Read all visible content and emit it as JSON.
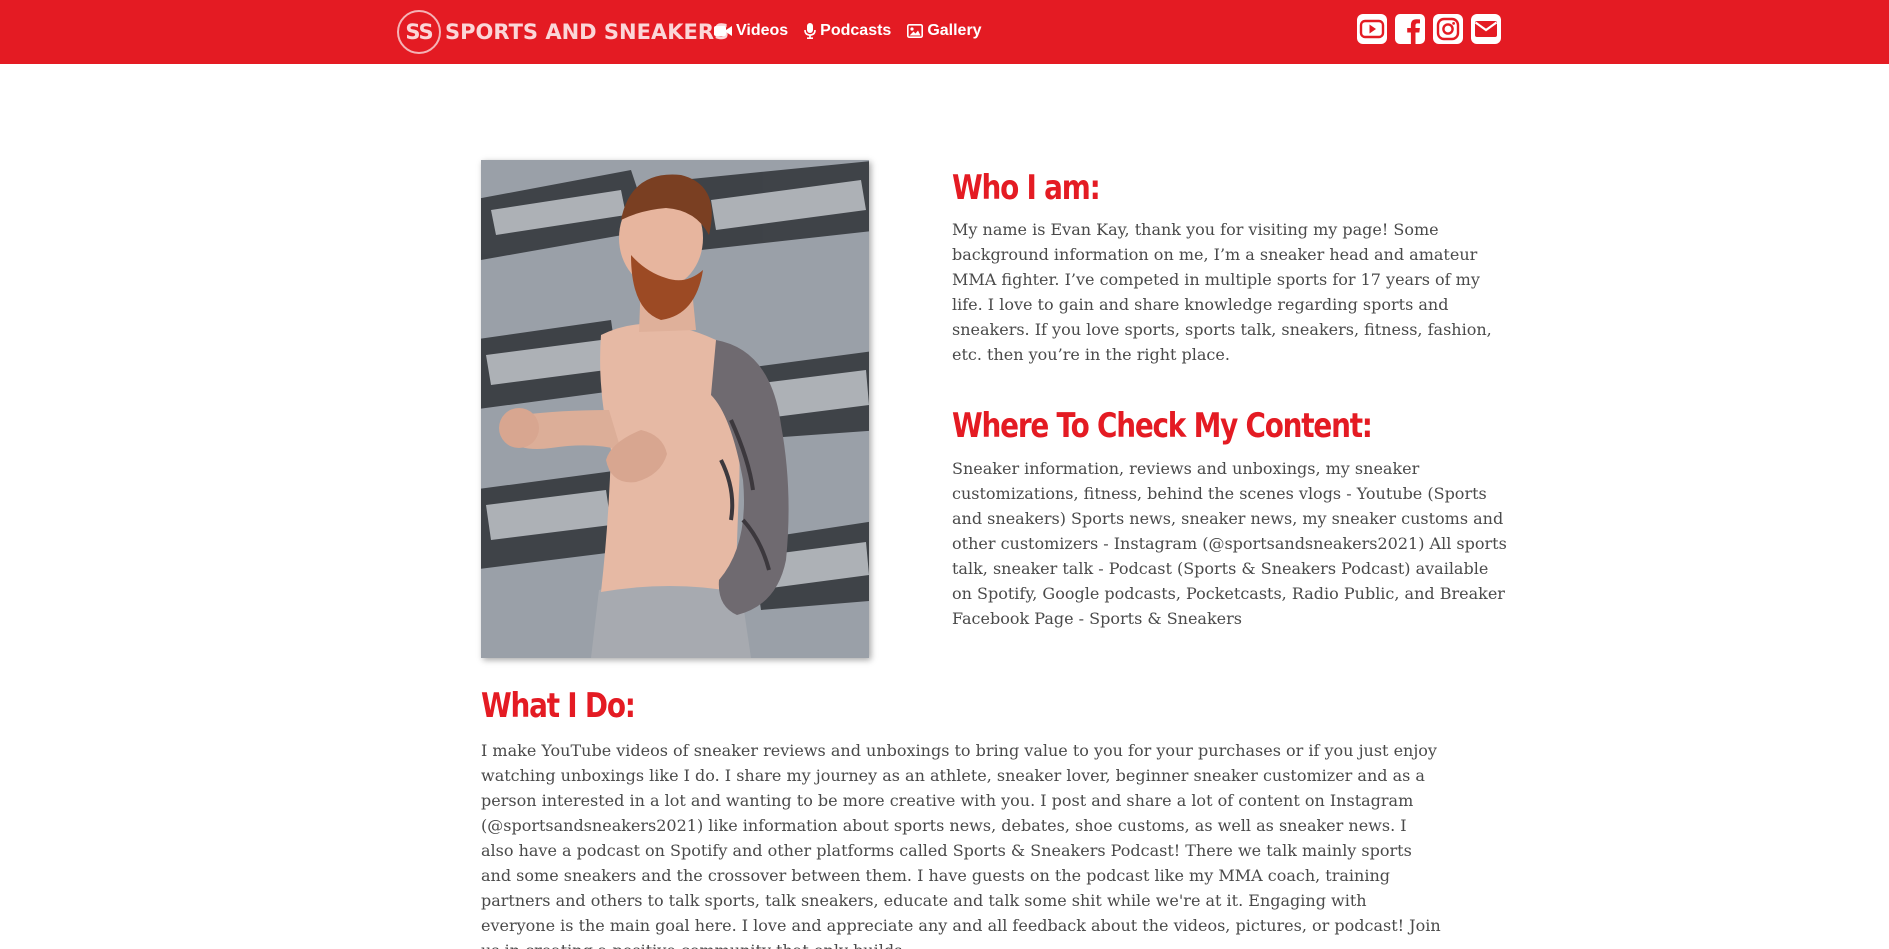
{
  "nav": {
    "logo_initials": "SS",
    "brand_name": "SPORTS AND SNEAKERS",
    "links": [
      {
        "label": "Videos",
        "icon": "video-camera-icon"
      },
      {
        "label": "Podcasts",
        "icon": "microphone-icon"
      },
      {
        "label": "Gallery",
        "icon": "image-icon"
      }
    ],
    "social": [
      {
        "name": "youtube",
        "icon": "youtube-icon"
      },
      {
        "name": "facebook",
        "icon": "facebook-icon"
      },
      {
        "name": "instagram",
        "icon": "instagram-icon"
      },
      {
        "name": "email",
        "icon": "envelope-icon"
      }
    ]
  },
  "colors": {
    "brand_red": "#e41b23",
    "body_text": "#4a4a4a"
  },
  "about": {
    "photo_alt": "Evan Kay in fighting stance",
    "who_heading": "Who I am:",
    "who_text": "My name is Evan Kay, thank you for visiting my page! Some background information on me, I’m a sneaker head and amateur MMA fighter. I’ve competed in multiple sports for 17 years of my life. I love to gain and share knowledge regarding sports and sneakers. If you love sports, sports talk, sneakers, fitness, fashion, etc. then you’re in the right place.",
    "where_heading": "Where To Check My Content:",
    "where_text": "Sneaker information, reviews and unboxings, my sneaker customizations, fitness, behind the scenes vlogs - Youtube (Sports and sneakers) Sports news, sneaker news, my sneaker customs and other customizers - Instagram (@sportsandsneakers2021) All sports talk, sneaker talk - Podcast (Sports & Sneakers Podcast) available on Spotify, Google podcasts, Pocketcasts, Radio Public, and Breaker Facebook Page - Sports & Sneakers",
    "what_heading": "What I Do:",
    "what_text": "I make YouTube videos of sneaker reviews and unboxings to bring value to you for your purchases or if you just enjoy watching unboxings like I do. I share my journey as an athlete, sneaker lover, beginner sneaker customizer and as a person interested in a lot and wanting to be more creative with you. I post and share a lot of content on Instagram (@sportsandsneakers2021) like information about sports news, debates, shoe customs, as well as sneaker news. I also have a podcast on Spotify and other platforms called Sports & Sneakers Podcast! There we talk mainly sports and some sneakers and the crossover between them. I have guests on the podcast like my MMA coach, training partners and others to talk sports, talk sneakers, educate and talk some shit while we're at it. Engaging with everyone is the main goal here. I love and appreciate any and all feedback about the videos, pictures, or podcast! Join us in creating a positive community that only builds."
  }
}
